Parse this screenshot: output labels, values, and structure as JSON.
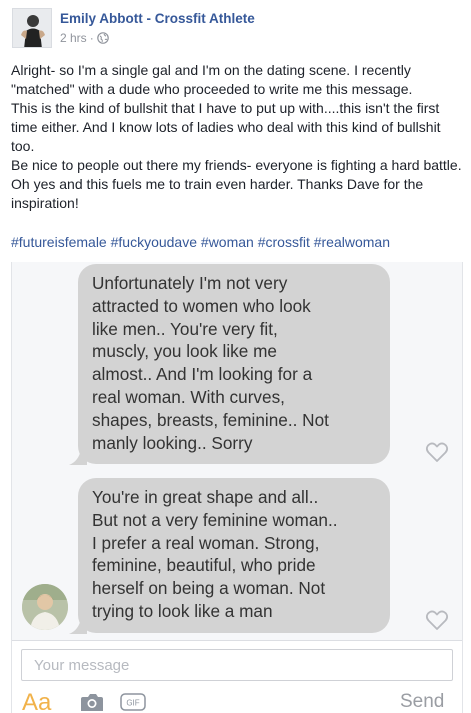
{
  "post": {
    "author": "Emily Abbott - Crossfit Athlete",
    "time": "2 hrs",
    "separator": "·",
    "privacy_icon": "globe-icon",
    "paragraphs": [
      "Alright- so I'm a single gal and I'm on the dating scene. I recently \"matched\" with a dude who proceeded to write me this message.",
      "This is the kind of bullshit that I have to put up with....this isn't the first time either. And I know lots of ladies who deal with this kind of bullshit too.",
      "Be nice to people out there my friends- everyone is fighting a hard battle.",
      "Oh yes and this fuels me to train even harder. Thanks Dave for the inspiration!"
    ],
    "hashtags": [
      "#futureisfemale",
      "#fuckyoudave",
      "#woman",
      "#crossfit",
      "#realwoman"
    ]
  },
  "screenshot": {
    "messages": [
      {
        "lines": [
          "Unfortunately I'm not very",
          "attracted to women who look",
          "like men.. You're very fit,",
          "muscly, you look like me",
          "almost.. And I'm looking for a",
          "real woman. With curves,",
          "shapes, breasts, feminine.. Not",
          "manly looking.. Sorry"
        ]
      },
      {
        "lines": [
          "You're in great shape and all..",
          "But not a very feminine woman..",
          "I prefer a real woman. Strong,",
          "feminine, beautiful, who pride",
          "herself on being a woman. Not",
          "trying to look like a man"
        ]
      }
    ],
    "compose": {
      "placeholder": "Your message",
      "value": "",
      "font_button": "Aa",
      "camera_icon": "camera-icon",
      "gif_label": "GIF",
      "send_label": "Send"
    },
    "bubble_color": "#d3d3d3",
    "accent_color": "#f1b24a"
  }
}
